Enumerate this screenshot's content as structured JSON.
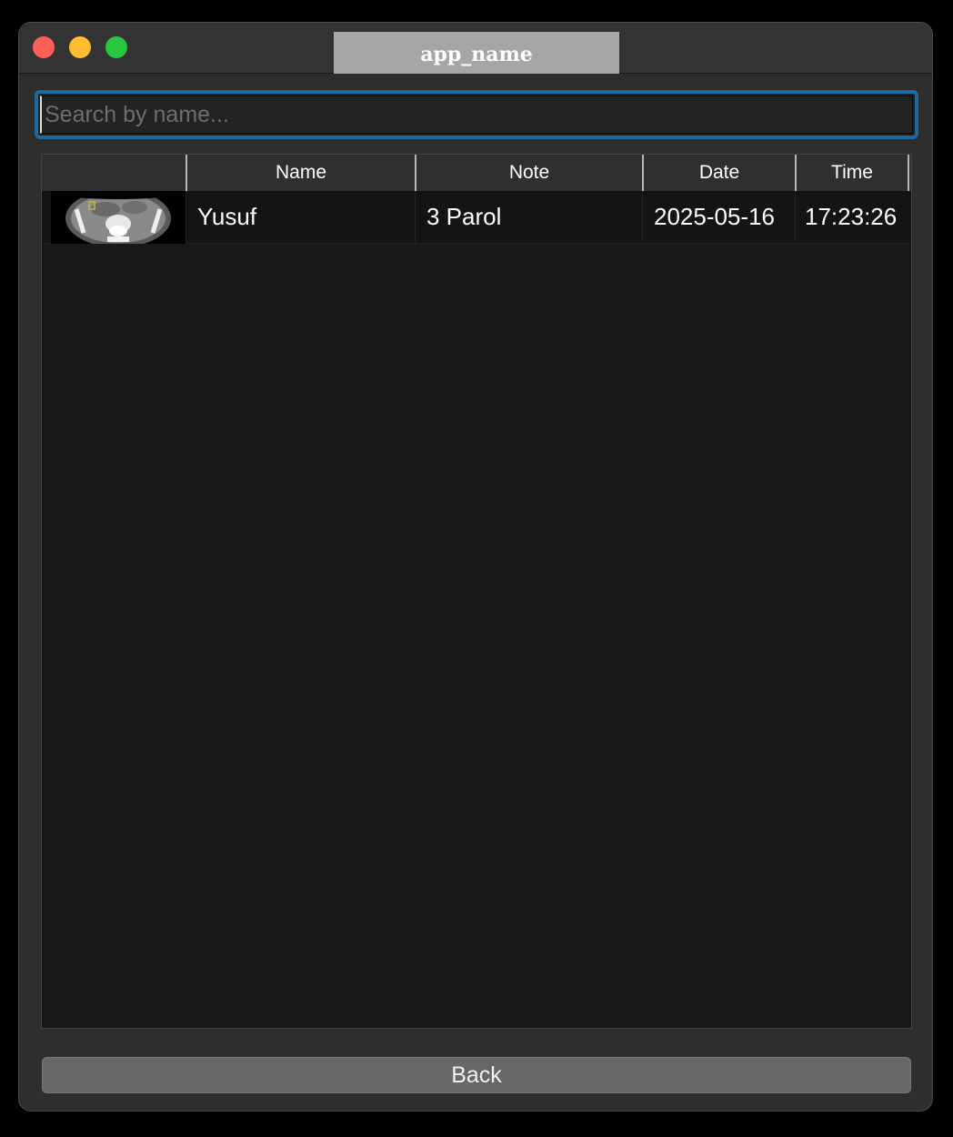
{
  "window": {
    "title": "app_name"
  },
  "search": {
    "placeholder": "Search by name...",
    "value": ""
  },
  "table": {
    "columns": [
      "",
      "Name",
      "Note",
      "Date",
      "Time"
    ],
    "rows": [
      {
        "thumbnail": "ct-scan-thumbnail",
        "name": "Yusuf",
        "note": "3 Parol",
        "date": "2025-05-16",
        "time": "17:23:26"
      }
    ]
  },
  "footer": {
    "back_label": "Back"
  },
  "colors": {
    "search_focus_ring": "#1d6aa0",
    "close": "#fe5f57",
    "minimize": "#febc2e",
    "maximize": "#28c840"
  }
}
